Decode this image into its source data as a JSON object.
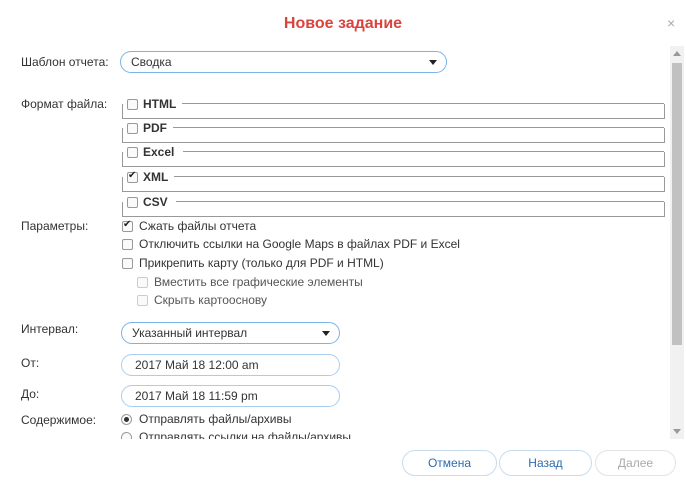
{
  "dialog": {
    "title": "Новое задание",
    "close": "×"
  },
  "template": {
    "label": "Шаблон отчета:",
    "value": "Сводка"
  },
  "file_format": {
    "label": "Формат файла:",
    "formats": [
      {
        "name": "HTML",
        "checked": false
      },
      {
        "name": "PDF",
        "checked": false
      },
      {
        "name": "Excel",
        "checked": false
      },
      {
        "name": "XML",
        "checked": true
      },
      {
        "name": "CSV",
        "checked": false
      }
    ]
  },
  "params": {
    "label": "Параметры:",
    "options": [
      {
        "label": "Сжать файлы отчета",
        "checked": true
      },
      {
        "label": "Отключить ссылки на Google Maps в файлах PDF и Excel",
        "checked": false
      },
      {
        "label": "Прикрепить карту (только для PDF и HTML)",
        "checked": false
      },
      {
        "label": "Вместить все графические элементы",
        "checked": false,
        "disabled": true
      },
      {
        "label": "Скрыть картооснову",
        "checked": false,
        "disabled": true
      }
    ]
  },
  "interval": {
    "label": "Интервал:",
    "value": "Указанный интервал"
  },
  "from": {
    "label": "От:",
    "value": "2017 Май 18 12:00 am"
  },
  "to": {
    "label": "До:",
    "value": "2017 Май 18 11:59 pm"
  },
  "content": {
    "label": "Содержимое:",
    "options": [
      {
        "label": "Отправлять файлы/архивы",
        "selected": true
      },
      {
        "label": "Отправлять ссылки на файлы/архивы",
        "selected": false
      }
    ]
  },
  "buttons": {
    "cancel": "Отмена",
    "back": "Назад",
    "next": "Далее"
  },
  "colors": {
    "title": "#d9453e",
    "link": "#2b6cb0",
    "border": "#7ab3e8"
  }
}
